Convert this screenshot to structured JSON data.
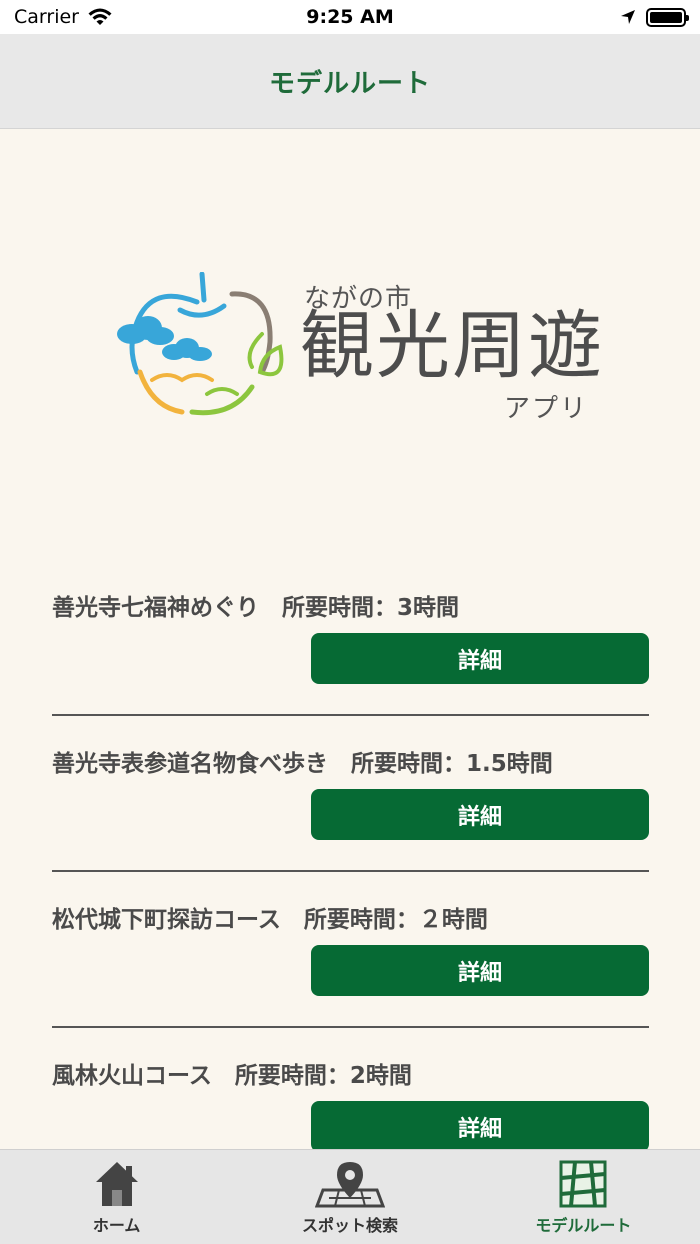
{
  "status_bar": {
    "carrier": "Carrier",
    "time": "9:25 AM"
  },
  "header": {
    "title": "モデルルート"
  },
  "logo": {
    "small_text": "ながの市",
    "main_text": "観光周遊",
    "sub_text": "アプリ"
  },
  "routes": [
    {
      "title": "善光寺七福神めぐり　所要時間：3時間",
      "button_label": "詳細"
    },
    {
      "title": "善光寺表参道名物食べ歩き　所要時間：1.5時間",
      "button_label": "詳細"
    },
    {
      "title": "松代城下町探訪コース　所要時間：２時間",
      "button_label": "詳細"
    },
    {
      "title": "風林火山コース　所要時間：2時間",
      "button_label": "詳細"
    }
  ],
  "tab_bar": {
    "tabs": [
      {
        "label": "ホーム",
        "icon": "house-icon"
      },
      {
        "label": "スポット検索",
        "icon": "map-pin-icon"
      },
      {
        "label": "モデルルート",
        "icon": "route-map-icon"
      }
    ],
    "active_index": 2
  },
  "colors": {
    "accent_green": "#066a34",
    "title_green": "#1f6b3a",
    "background": "#faf6ee"
  }
}
